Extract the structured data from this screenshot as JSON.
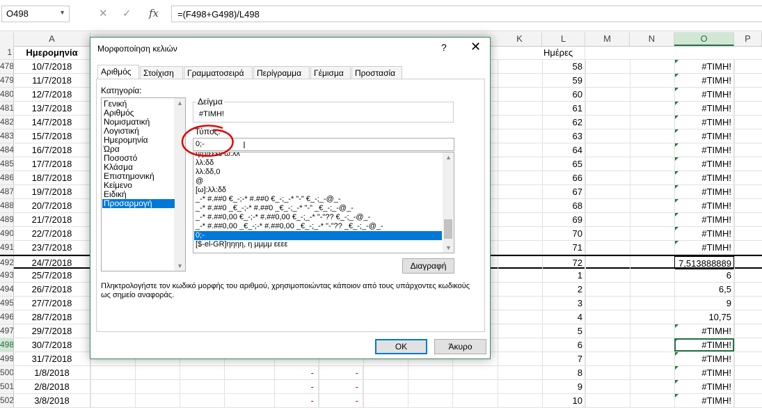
{
  "formula_bar": {
    "name_box": "O498",
    "cancel_icon": "✕",
    "enter_icon": "✓",
    "fx_icon": "fx",
    "formula": "=(F498+G498)/L498"
  },
  "column_headers": [
    "A",
    "K",
    "L",
    "M",
    "N",
    "O",
    "P"
  ],
  "header_row": {
    "row": "1",
    "a": "Ημερομηνία",
    "l": "Ημέρες"
  },
  "rows": [
    {
      "rn": "478",
      "a": "10/7/2018",
      "l": "58",
      "o": "#ΤΙΜΗ!"
    },
    {
      "rn": "479",
      "a": "11/7/2018",
      "l": "59",
      "o": "#ΤΙΜΗ!"
    },
    {
      "rn": "480",
      "a": "12/7/2018",
      "l": "60",
      "o": "#ΤΙΜΗ!"
    },
    {
      "rn": "481",
      "a": "13/7/2018",
      "l": "61",
      "o": "#ΤΙΜΗ!"
    },
    {
      "rn": "482",
      "a": "14/7/2018",
      "l": "62",
      "o": "#ΤΙΜΗ!"
    },
    {
      "rn": "483",
      "a": "15/7/2018",
      "l": "63",
      "o": "#ΤΙΜΗ!"
    },
    {
      "rn": "484",
      "a": "16/7/2018",
      "l": "64",
      "o": "#ΤΙΜΗ!"
    },
    {
      "rn": "485",
      "a": "17/7/2018",
      "l": "65",
      "o": "#ΤΙΜΗ!"
    },
    {
      "rn": "486",
      "a": "18/7/2018",
      "l": "66",
      "o": "#ΤΙΜΗ!"
    },
    {
      "rn": "487",
      "a": "19/7/2018",
      "l": "67",
      "o": "#ΤΙΜΗ!"
    },
    {
      "rn": "488",
      "a": "20/7/2018",
      "l": "68",
      "o": "#ΤΙΜΗ!"
    },
    {
      "rn": "489",
      "a": "21/7/2018",
      "l": "69",
      "o": "#ΤΙΜΗ!"
    },
    {
      "rn": "490",
      "a": "22/7/2018",
      "l": "70",
      "o": "#ΤΙΜΗ!"
    },
    {
      "rn": "491",
      "a": "23/7/2018",
      "l": "71",
      "o": "#ΤΙΜΗ!"
    },
    {
      "rn": "492",
      "a": "24/7/2018",
      "l": "72",
      "o": "7,513888889"
    },
    {
      "rn": "493",
      "a": "25/7/2018",
      "l": "1",
      "o": "6"
    },
    {
      "rn": "494",
      "a": "26/7/2018",
      "l": "2",
      "o": "6,5"
    },
    {
      "rn": "495",
      "a": "27/7/2018",
      "l": "3",
      "o": "9"
    },
    {
      "rn": "496",
      "a": "28/7/2018",
      "l": "4",
      "o": "10,75"
    },
    {
      "rn": "497",
      "a": "29/7/2018",
      "l": "5",
      "o": "#ΤΙΜΗ!"
    },
    {
      "rn": "498",
      "a": "30/7/2018",
      "l": "6",
      "o": "#ΤΙΜΗ!"
    },
    {
      "rn": "499",
      "a": "31/7/2018",
      "l": "7",
      "o": "#ΤΙΜΗ!"
    },
    {
      "rn": "500",
      "a": "1/8/2018",
      "l": "8",
      "o": "#ΤΙΜΗ!"
    },
    {
      "rn": "501",
      "a": "2/8/2018",
      "l": "9",
      "o": "#ΤΙΜΗ!"
    },
    {
      "rn": "502",
      "a": "3/8/2018",
      "l": "10",
      "o": "#ΤΙΜΗ!"
    }
  ],
  "dash": "-",
  "dialog": {
    "title": "Μορφοποίηση κελιών",
    "help": "?",
    "close": "✕",
    "tabs": [
      "Αριθμός",
      "Στοίχιση",
      "Γραμματοσειρά",
      "Περίγραμμα",
      "Γέμισμα",
      "Προστασία"
    ],
    "category_label": "Κατηγορία:",
    "categories": [
      "Γενική",
      "Αριθμός",
      "Νομισματική",
      "Λογιστική",
      "Ημερομηνία",
      "Ώρα",
      "Ποσοστό",
      "Κλάσμα",
      "Επιστημονική",
      "Κείμενο",
      "Ειδική",
      "Προσαρμογή"
    ],
    "sample_label": "Δείγμα",
    "sample_value": "#ΤΙΜΗ!",
    "type_label": "Τύπος:",
    "type_value": "0;-",
    "type_list": [
      "η/μ/εεεε ω:λλ",
      "λλ:δδ",
      "λλ:δδ,0",
      "@",
      "[ω]:λλ:δδ",
      "_-* #.##0 €_-;-* #.##0 €_-;_-* \"-\" €_-;_-@_-",
      "_-* #.##0 _€_-;-* #.##0 _€_-;_-* \"-\" _€_-;_-@_-",
      "_-* #.##0,00 €_-;-* #.##0,00 €_-;_-* \"-\"?? €_-;_-@_-",
      "_-* #.##0,00 _€_-;-* #.##0,00 _€_-;_-* \"-\"?? _€_-;_-@_-",
      "0;-",
      "[$-el-GR]ηηηη, η μμμμ εεεε"
    ],
    "delete_button": "Διαγραφή",
    "hint": "Πληκτρολογήστε τον κωδικό μορφής του αριθμού, χρησιμοποιώντας κάποιον από τους υπάρχοντες κωδικούς ως σημείο αναφοράς.",
    "ok_button": "OK",
    "cancel_button": "Άκυρο"
  },
  "colors": {
    "accent": "#217346",
    "selection": "#0078d7",
    "annotation": "#e00000",
    "error_dash": "#d00000"
  }
}
